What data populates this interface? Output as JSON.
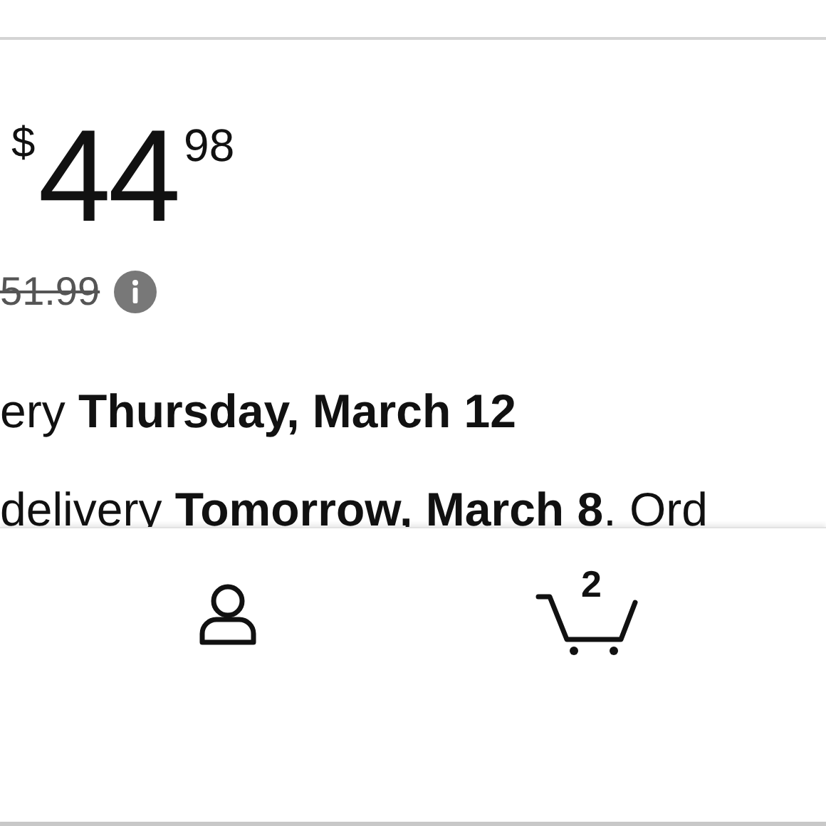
{
  "price": {
    "currency": "$",
    "whole": "44",
    "fraction": "98"
  },
  "list_price": "51.99",
  "delivery": "ery **Thursday, March 12**",
  "fastest_delivery": "delivery **Tomorrow, March 8**. Ord",
  "bottom_nav": [
    {
      "kind": "account"
    },
    {
      "kind": "cart",
      "badge": "2"
    }
  ]
}
